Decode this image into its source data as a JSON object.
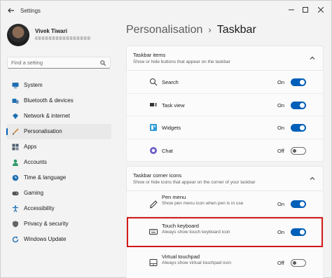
{
  "window": {
    "title": "Settings"
  },
  "profile": {
    "name": "Vivek Tiwari"
  },
  "search": {
    "placeholder": "Find a setting"
  },
  "sidebar": {
    "items": [
      {
        "label": "System",
        "icon": "monitor-icon",
        "color": "#1f6fb2"
      },
      {
        "label": "Bluetooth & devices",
        "icon": "bluetooth-icon",
        "color": "#1f6fb2"
      },
      {
        "label": "Network & internet",
        "icon": "wifi-icon",
        "color": "#1f6fb2"
      },
      {
        "label": "Personalisation",
        "icon": "brush-icon",
        "color": "#c7721a",
        "active": true
      },
      {
        "label": "Apps",
        "icon": "apps-icon",
        "color": "#4a5a6a"
      },
      {
        "label": "Accounts",
        "icon": "person-icon",
        "color": "#2e9b6a"
      },
      {
        "label": "Time & language",
        "icon": "globe-clock-icon",
        "color": "#1f6fb2"
      },
      {
        "label": "Gaming",
        "icon": "gamepad-icon",
        "color": "#555555"
      },
      {
        "label": "Accessibility",
        "icon": "accessibility-icon",
        "color": "#1f6fb2"
      },
      {
        "label": "Privacy & security",
        "icon": "shield-icon",
        "color": "#666666"
      },
      {
        "label": "Windows Update",
        "icon": "update-icon",
        "color": "#1f6fb2"
      }
    ]
  },
  "breadcrumb": {
    "parent": "Personalisation",
    "separator": "›",
    "current": "Taskbar"
  },
  "sections": [
    {
      "title": "Taskbar items",
      "subtitle": "Show or hide buttons that appear on the taskbar",
      "rows": [
        {
          "label": "Search",
          "icon": "search-icon",
          "state": "On",
          "on": true
        },
        {
          "label": "Task view",
          "icon": "task-view-icon",
          "state": "On",
          "on": true
        },
        {
          "label": "Widgets",
          "icon": "widgets-icon",
          "state": "On",
          "on": true
        },
        {
          "label": "Chat",
          "icon": "chat-icon",
          "state": "Off",
          "on": false
        }
      ]
    },
    {
      "title": "Taskbar corner icons",
      "subtitle": "Show or hide icons that appear on the corner of your taskbar",
      "rows": [
        {
          "label": "Pen menu",
          "desc": "Show pen menu icon when pen is in use",
          "icon": "pen-icon",
          "state": "On",
          "on": true
        },
        {
          "label": "Touch keyboard",
          "desc": "Always show touch keyboard icon",
          "icon": "keyboard-icon",
          "state": "On",
          "on": true,
          "highlighted": true
        },
        {
          "label": "Virtual touchpad",
          "desc": "Always show virtual touchpad icon",
          "icon": "touchpad-icon",
          "state": "Off",
          "on": false
        }
      ]
    }
  ],
  "colors": {
    "accent": "#005fb8",
    "highlight": "#d21a1a"
  }
}
